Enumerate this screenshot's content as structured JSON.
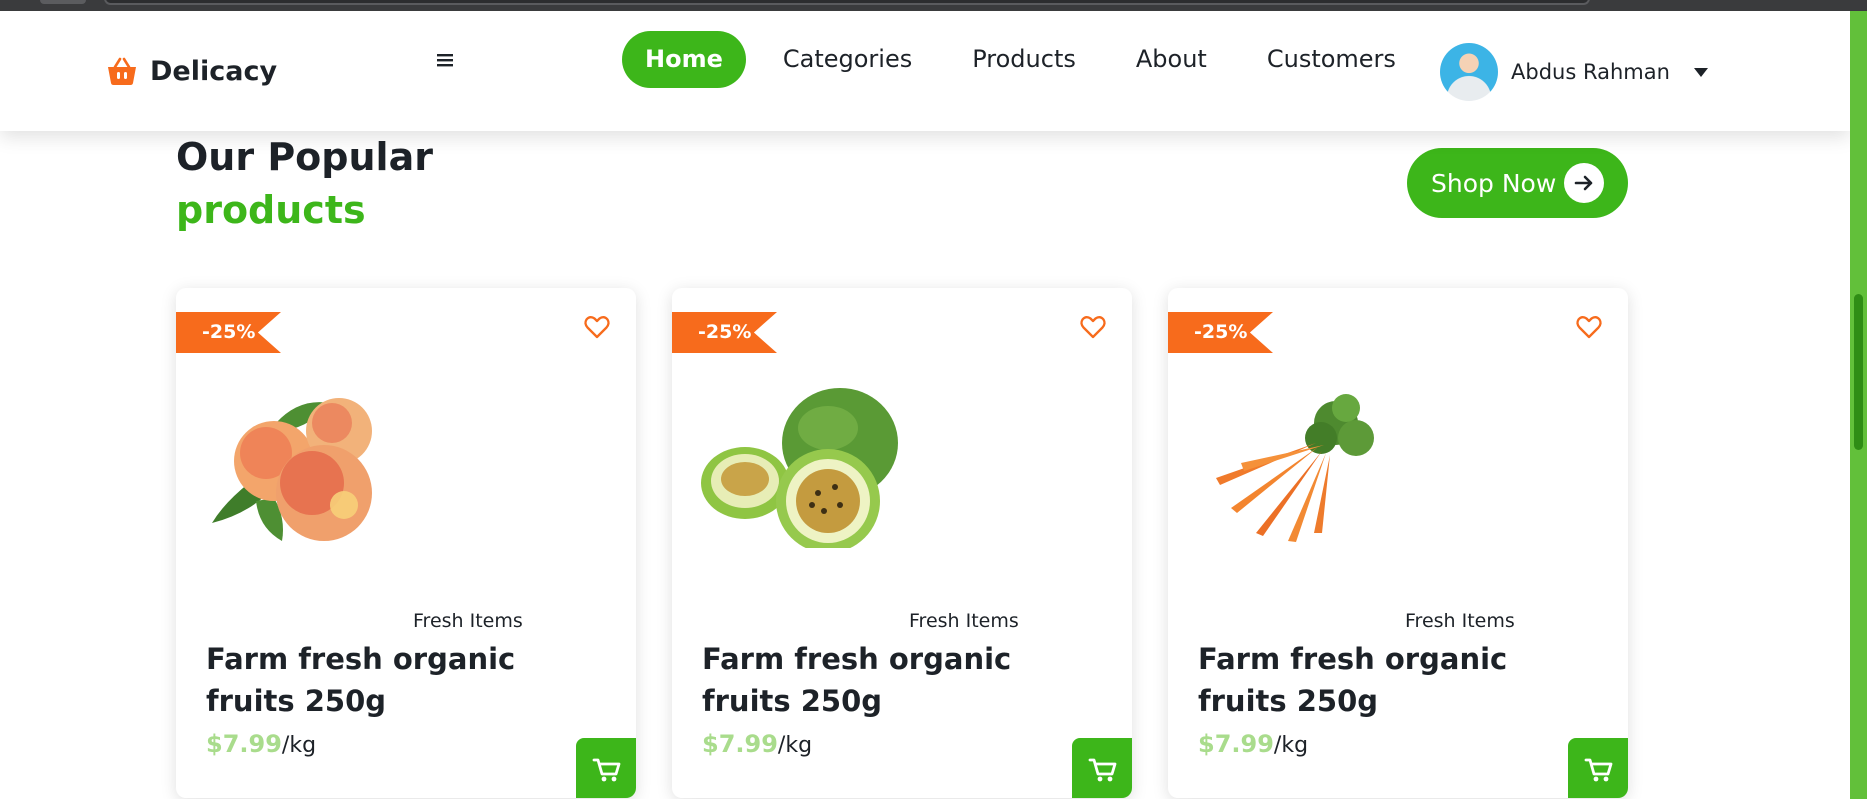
{
  "brand": {
    "name": "Delicacy",
    "accent": "#3db61a",
    "orange": "#f76b1c"
  },
  "nav": {
    "items": [
      {
        "label": "Home",
        "active": true
      },
      {
        "label": "Categories",
        "active": false
      },
      {
        "label": "Products",
        "active": false
      },
      {
        "label": "About",
        "active": false
      },
      {
        "label": "Customers",
        "active": false
      }
    ]
  },
  "user": {
    "name": "Abdus Rahman"
  },
  "section": {
    "title_line1": "Our Popular",
    "title_line2": "products",
    "cta_label": "Shop Now"
  },
  "products": [
    {
      "discount": "-25%",
      "category": "Fresh Items",
      "title": "Farm fresh organic fruits 250g",
      "price": "$7.99",
      "unit": "/kg",
      "image": "peaches"
    },
    {
      "discount": "-25%",
      "category": "Fresh Items",
      "title": "Farm fresh organic fruits 250g",
      "price": "$7.99",
      "unit": "/kg",
      "image": "passion-fruit"
    },
    {
      "discount": "-25%",
      "category": "Fresh Items",
      "title": "Farm fresh organic fruits 250g",
      "price": "$7.99",
      "unit": "/kg",
      "image": "carrots"
    }
  ],
  "icons": {
    "logo": "basket-icon",
    "menu": "hamburger-icon",
    "favorite": "heart-icon",
    "cart": "cart-icon",
    "cta": "arrow-right-icon",
    "dropdown": "caret-down-icon"
  }
}
